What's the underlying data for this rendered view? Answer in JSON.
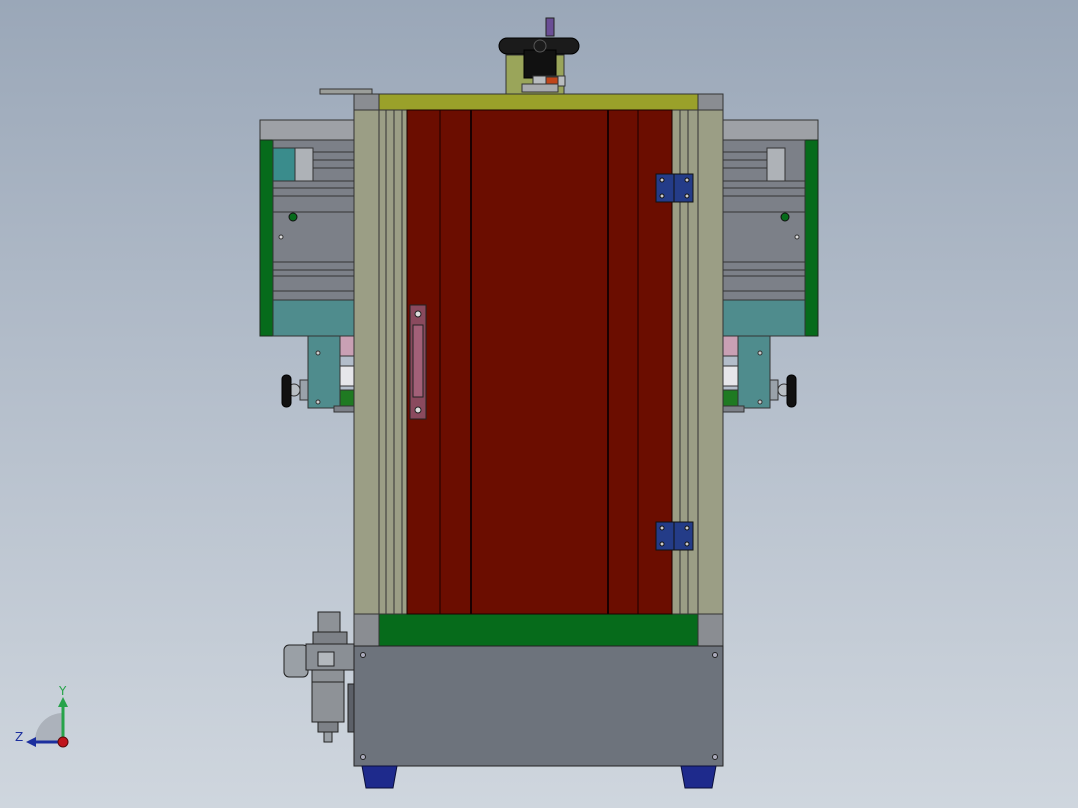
{
  "view": {
    "background_top": "#9aa7b8",
    "background_bottom": "#cfd6de",
    "model_colors": {
      "door": "#6b0d00",
      "frame": "#9b9e85",
      "base_cabinet": "#6d737c",
      "green_panel": "#066b1b",
      "hinge": "#243c88",
      "feet": "#1e2a8c",
      "teal_block": "#4f8c8d"
    }
  },
  "triad": {
    "y_label": "Y",
    "z_label": "Z",
    "y_color": "#27a34a",
    "z_color": "#1c2f9e",
    "origin_color": "#c0141c"
  }
}
